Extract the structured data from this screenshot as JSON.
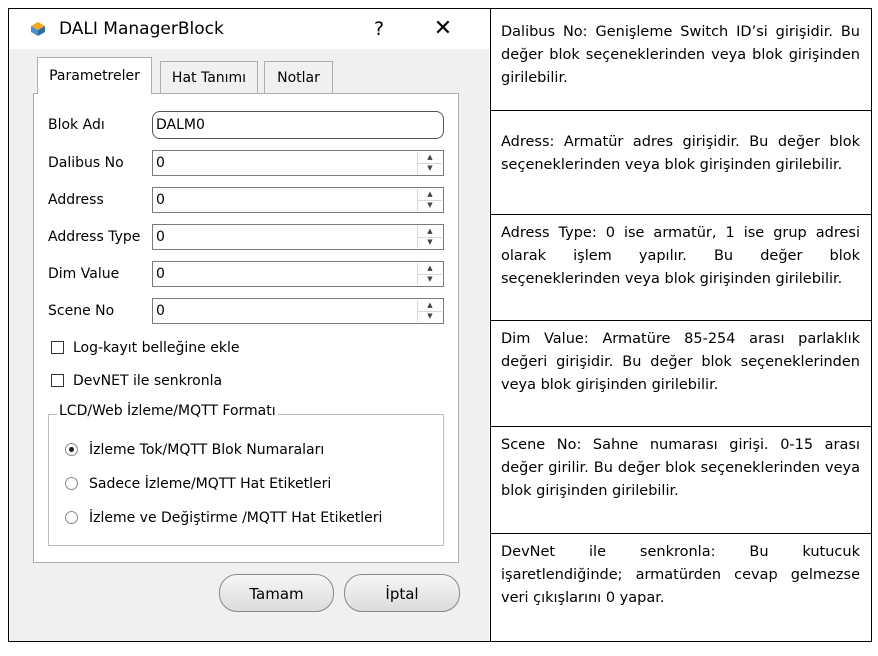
{
  "dialog": {
    "title": "DALI ManagerBlock",
    "help_label": "?",
    "close_label": "✕",
    "tabs": [
      {
        "label": "Parametreler",
        "active": true
      },
      {
        "label": "Hat Tanımı",
        "active": false
      },
      {
        "label": "Notlar",
        "active": false
      }
    ],
    "fields": {
      "block_name": {
        "label": "Blok Adı",
        "value": "DALM0"
      },
      "dalibus_no": {
        "label": "Dalibus No",
        "value": "0"
      },
      "address": {
        "label": "Address",
        "value": "0"
      },
      "address_type": {
        "label": "Address Type",
        "value": "0"
      },
      "dim_value": {
        "label": "Dim Value",
        "value": "0"
      },
      "scene_no": {
        "label": "Scene No",
        "value": "0"
      }
    },
    "checkboxes": {
      "log": {
        "label": "Log-kayıt belleğine ekle",
        "checked": false
      },
      "devnet": {
        "label": "DevNET ile senkronla",
        "checked": false
      }
    },
    "format_group": {
      "title": "LCD/Web İzleme/MQTT Formatı",
      "options": [
        {
          "label": "İzleme Tok/MQTT Blok Numaraları",
          "selected": true
        },
        {
          "label": "Sadece İzleme/MQTT Hat Etiketleri",
          "selected": false
        },
        {
          "label": "İzleme ve Değiştirme /MQTT Hat Etiketleri",
          "selected": false
        }
      ]
    },
    "buttons": {
      "ok": "Tamam",
      "cancel": "İptal"
    }
  },
  "descriptions": [
    "Dalibus No:  Genişleme Switch ID’si girişidir. Bu değer blok seçeneklerinden veya blok girişinden girilebilir.",
    "Adress:  Armatür adres girişidir. Bu değer blok seçeneklerinden veya blok girişinden girilebilir.",
    "Adress Type:  0 ise armatür, 1 ise grup adresi olarak işlem yapılır. Bu değer blok seçeneklerinden veya blok girişinden girilebilir.",
    "Dim Value:  Armatüre 85-254 arası parlaklık değeri girişidir. Bu değer blok seçeneklerinden veya blok girişinden girilebilir.",
    "Scene No:  Sahne numarası girişi. 0-15 arası değer girilir. Bu değer blok seçeneklerinden veya blok girişinden girilebilir.",
    "DevNet ile senkronla:  Bu kutucuk işaretlendiğinde; armatürden cevap gelmezse veri çıkışlarını 0 yapar."
  ]
}
